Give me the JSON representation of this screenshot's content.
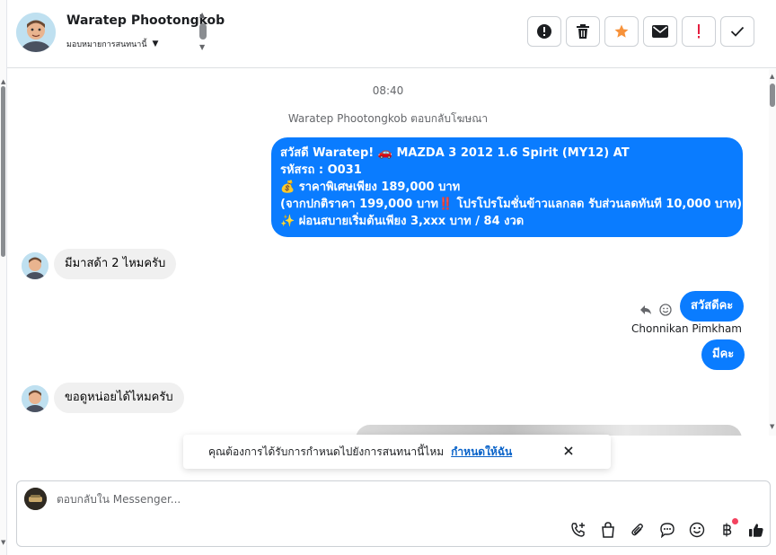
{
  "header": {
    "contact_name": "Waratep Phootongkob",
    "assign_label": "มอบหมายการสนทนานี้",
    "actions": [
      {
        "name": "report-button",
        "icon": "alert-circle-icon"
      },
      {
        "name": "delete-button",
        "icon": "trash-icon"
      },
      {
        "name": "star-button",
        "icon": "star-icon"
      },
      {
        "name": "mark-unread-button",
        "icon": "envelope-icon"
      },
      {
        "name": "spam-button",
        "icon": "exclamation-icon"
      },
      {
        "name": "done-button",
        "icon": "check-icon"
      }
    ]
  },
  "conversation": {
    "timestamp": "08:40",
    "reply_note": "Waratep Phootongkob ตอบกลับโฆษณา",
    "promo_message": {
      "line1": "สวัสดี Waratep! 🚗 MAZDA 3 2012 1.6 Spirit (MY12) AT",
      "line2": " รหัสรถ : O031",
      "line3": "💰 ราคาพิเศษเพียง 189,000 บาท",
      "line4": "(จากปกติราคา 199,000 บาท‼️ โปรโปรโมชั่นข้าวแลกลด รับส่วนลดทันที 10,000 บาท)",
      "line5": "✨ ผ่อนสบายเริ่มต้นเพียง 3,xxx บาท / 84 งวด"
    },
    "incoming_1": "มีมาสด้า 2 ไหมครับ",
    "outgoing_2": "สวัสดีคะ",
    "sender_name": "Chonnikan Pimkham",
    "outgoing_3": "มีคะ",
    "incoming_2": "ขอดูหน่อยได้ไหมครับ"
  },
  "toast": {
    "text": "คุณต้องการได้รับการกำหนดไปยังการสนทนานี้ไหม",
    "link": "กำหนดให้ฉัน"
  },
  "composer": {
    "placeholder": "ตอบกลับใน Messenger...",
    "tools": [
      "call-icon",
      "shopping-bag-icon",
      "attachment-icon",
      "saved-reply-icon",
      "emoji-icon",
      "baht-icon",
      "thumbs-up-icon"
    ]
  },
  "colors": {
    "accent": "#0a7cff",
    "star": "#f7923a",
    "spam": "#e41e3f",
    "link": "#0a63c9"
  }
}
